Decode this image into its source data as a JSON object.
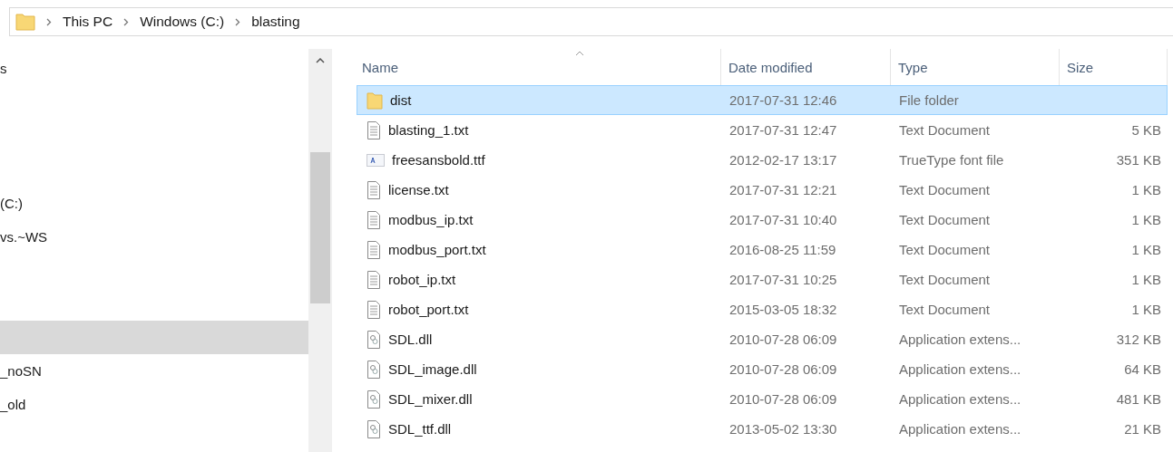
{
  "address_bar": {
    "breadcrumbs": [
      "This PC",
      "Windows (C:)",
      "blasting"
    ]
  },
  "navigation_pane": {
    "groups": [
      {
        "items": [
          {
            "label": "s",
            "selected": false
          }
        ]
      },
      {
        "items": [
          {
            "label": "(C:)",
            "selected": false
          },
          {
            "label": "vs.~WS",
            "selected": false
          }
        ]
      },
      {
        "items": [
          {
            "selected": true
          },
          {
            "label": "_noSN",
            "selected": false
          },
          {
            "label": "_old",
            "selected": false
          }
        ]
      }
    ]
  },
  "file_list": {
    "columns": [
      "Name",
      "Date modified",
      "Type",
      "Size"
    ],
    "rows": [
      {
        "kind": "folder",
        "name": "dist",
        "date_modified": "2017-07-31 12:46",
        "type": "File folder",
        "selected": true
      },
      {
        "kind": "text",
        "name": "blasting_1.txt",
        "date_modified": "2017-07-31 12:47",
        "type": "Text Document",
        "size": "5 KB",
        "selected": false
      },
      {
        "kind": "font",
        "name": "freesansbold.ttf",
        "date_modified": "2012-02-17 13:17",
        "type": "TrueType font file",
        "size": "351 KB",
        "selected": false
      },
      {
        "kind": "text",
        "name": "license.txt",
        "date_modified": "2017-07-31 12:21",
        "type": "Text Document",
        "size": "1 KB",
        "selected": false
      },
      {
        "kind": "text",
        "name": "modbus_ip.txt",
        "date_modified": "2017-07-31 10:40",
        "type": "Text Document",
        "size": "1 KB",
        "selected": false
      },
      {
        "kind": "text",
        "name": "modbus_port.txt",
        "date_modified": "2016-08-25 11:59",
        "type": "Text Document",
        "size": "1 KB",
        "selected": false
      },
      {
        "kind": "text",
        "name": "robot_ip.txt",
        "date_modified": "2017-07-31 10:25",
        "type": "Text Document",
        "size": "1 KB",
        "selected": false
      },
      {
        "kind": "text",
        "name": "robot_port.txt",
        "date_modified": "2015-03-05 18:32",
        "type": "Text Document",
        "size": "1 KB",
        "selected": false
      },
      {
        "kind": "dll",
        "name": "SDL.dll",
        "date_modified": "2010-07-28 06:09",
        "type": "Application extens...",
        "size": "312 KB",
        "selected": false
      },
      {
        "kind": "dll",
        "name": "SDL_image.dll",
        "date_modified": "2010-07-28 06:09",
        "type": "Application extens...",
        "size": "64 KB",
        "selected": false
      },
      {
        "kind": "dll",
        "name": "SDL_mixer.dll",
        "date_modified": "2010-07-28 06:09",
        "type": "Application extens...",
        "size": "481 KB",
        "selected": false
      },
      {
        "kind": "dll",
        "name": "SDL_ttf.dll",
        "date_modified": "2013-05-02 13:30",
        "type": "Application extens...",
        "size": "21 KB",
        "selected": false
      }
    ]
  }
}
